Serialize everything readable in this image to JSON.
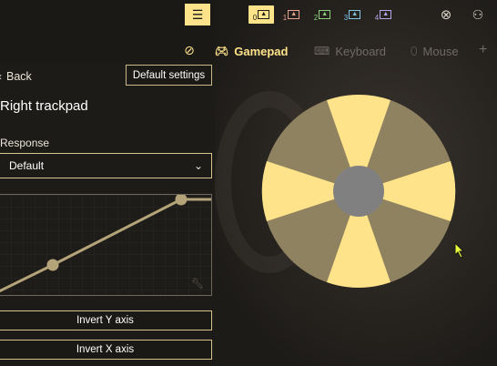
{
  "topbar": {
    "list_icon": "list-icon",
    "players": [
      {
        "num": "0",
        "icon": "controller-box-icon",
        "color": "#ffe38a",
        "active": true
      },
      {
        "num": "1",
        "icon": "controller-box-icon",
        "color": "#e8a390",
        "active": false
      },
      {
        "num": "2",
        "icon": "controller-box-icon",
        "color": "#8ad07a",
        "active": false
      },
      {
        "num": "3",
        "icon": "controller-box-icon",
        "color": "#7fc6e6",
        "active": false
      },
      {
        "num": "4",
        "icon": "controller-box-icon",
        "color": "#b6a7e8",
        "active": false
      }
    ],
    "xbox_icon": "xbox-icon",
    "person_icon": "person-settings-icon"
  },
  "tabs": {
    "visibility_icon": "eye-slash-icon",
    "gamepad": "Gamepad",
    "keyboard": "Keyboard",
    "mouse": "Mouse",
    "add_icon": "plus-icon"
  },
  "panel": {
    "back": "Back",
    "default_settings": "Default settings",
    "title": "Right trackpad",
    "response_label": "Response",
    "response_value": "Default",
    "invert_y": "Invert Y axis",
    "invert_x": "Invert X axis"
  },
  "colors": {
    "accent": "#ffe38a",
    "wheel_light": "#ffe38a",
    "wheel_dark": "#8f8260",
    "wheel_center": "#808080"
  }
}
